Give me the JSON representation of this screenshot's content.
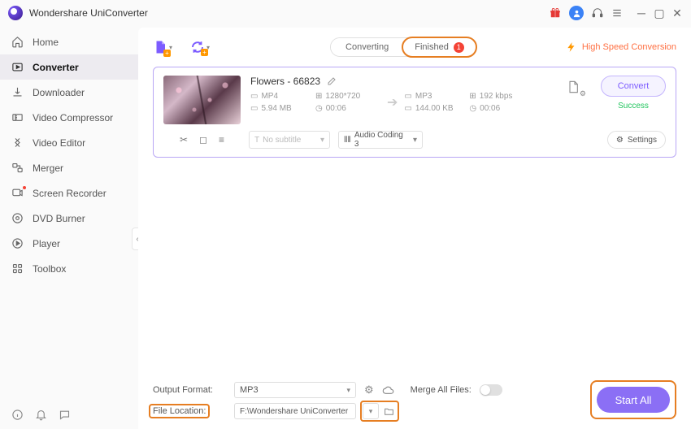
{
  "app": {
    "title": "Wondershare UniConverter"
  },
  "sidebar": {
    "items": [
      {
        "label": "Home"
      },
      {
        "label": "Converter"
      },
      {
        "label": "Downloader"
      },
      {
        "label": "Video Compressor"
      },
      {
        "label": "Video Editor"
      },
      {
        "label": "Merger"
      },
      {
        "label": "Screen Recorder"
      },
      {
        "label": "DVD Burner"
      },
      {
        "label": "Player"
      },
      {
        "label": "Toolbox"
      }
    ]
  },
  "tabs": {
    "converting": "Converting",
    "finished": "Finished",
    "finished_count": "1"
  },
  "speed_label": "High Speed Conversion",
  "file": {
    "name": "Flowers - 66823",
    "src": {
      "format": "MP4",
      "res": "1280*720",
      "size": "5.94 MB",
      "dur": "00:06"
    },
    "dst": {
      "format": "MP3",
      "bitrate": "192 kbps",
      "size": "144.00 KB",
      "dur": "00:06"
    },
    "subtitle_placeholder": "No subtitle",
    "audio_label": "Audio Coding 3",
    "settings_label": "Settings",
    "convert_label": "Convert",
    "status": "Success"
  },
  "bottom": {
    "output_format_label": "Output Format:",
    "output_format_value": "MP3",
    "merge_label": "Merge All Files:",
    "location_label": "File Location:",
    "location_value": "F:\\Wondershare UniConverter",
    "start_all": "Start All"
  }
}
